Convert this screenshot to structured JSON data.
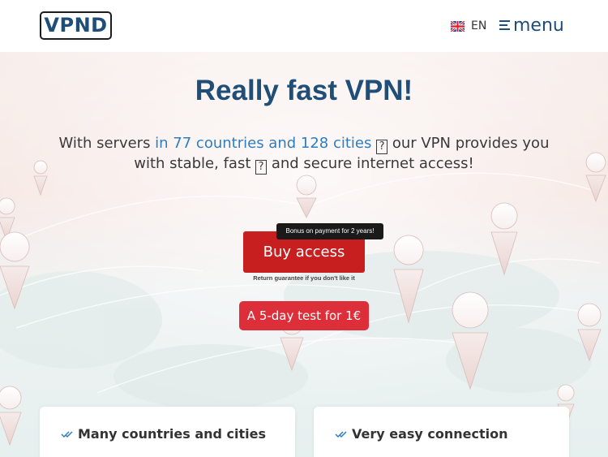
{
  "header": {
    "logo": "VPND",
    "language": "EN",
    "flag": "uk-flag-icon",
    "menu_icon": "hamburger-icon",
    "menu_label": "menu"
  },
  "hero": {
    "title": "Really fast VPN!",
    "subtitle_part1": "With servers ",
    "subtitle_link": "in 77 countries and 128 cities",
    "subtitle_part2": " our VPN provides you with stable, fast ",
    "subtitle_part3": " and secure internet access!",
    "help_glyph": "?",
    "bonus_tooltip": "Bonus on payment for 2 years!",
    "buy_label": "Buy access",
    "guarantee": "Return guarantee if you don't like it",
    "test_label": "A 5-day test for 1€"
  },
  "features": [
    {
      "title": "Many countries and cities",
      "icon": "double-check-icon"
    },
    {
      "title": "Very easy connection",
      "icon": "double-check-icon"
    }
  ],
  "colors": {
    "brand_blue": "#1f4e79",
    "link_blue": "#2f7dbf",
    "buy_red": "#c71f1f",
    "test_red": "#dc2f3a"
  }
}
